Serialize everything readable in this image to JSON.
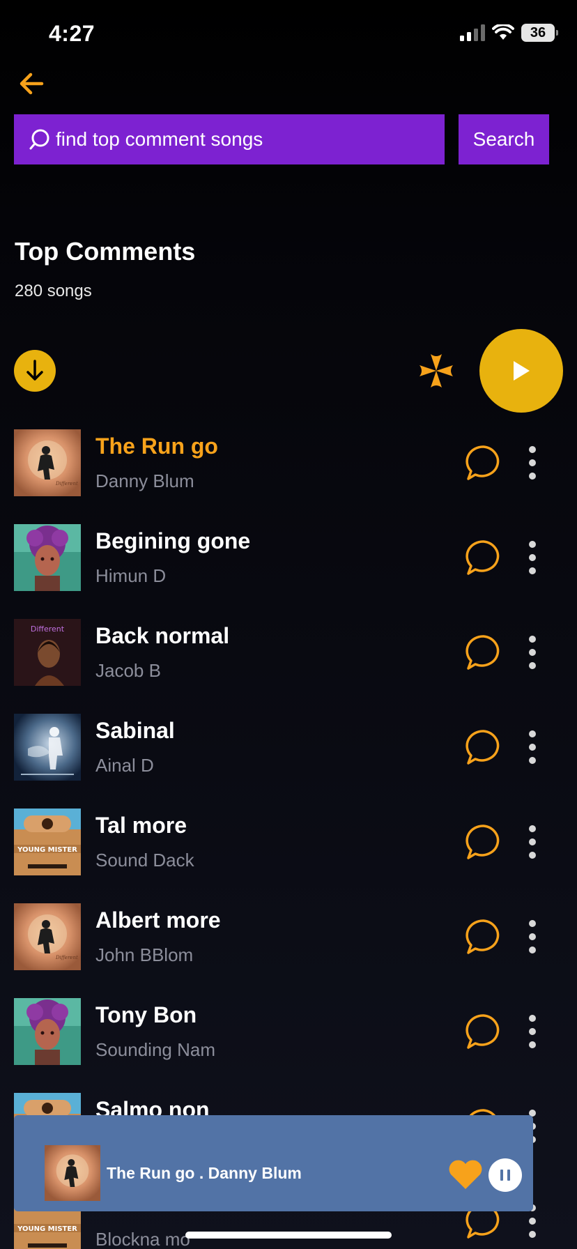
{
  "status_bar": {
    "time": "4:27",
    "battery": "36"
  },
  "search": {
    "placeholder": "find top comment songs",
    "value": "find top comment songs",
    "button_label": "Search"
  },
  "header": {
    "title": "Top Comments",
    "count": "280 songs"
  },
  "colors": {
    "accent": "#f7a21b",
    "purple": "#7d22d1",
    "gold": "#e8b20e",
    "player": "#5273a6"
  },
  "songs": [
    {
      "title": "The Run go",
      "artist": "Danny Blum",
      "art": "sunset-figure",
      "active": true
    },
    {
      "title": "Begining gone",
      "artist": "Himun D",
      "art": "purple-portrait",
      "active": false
    },
    {
      "title": "Back normal",
      "artist": "Jacob B",
      "art": "dark-portrait",
      "active": false
    },
    {
      "title": "Sabinal",
      "artist": "Ainal D",
      "art": "blue-dust",
      "active": false
    },
    {
      "title": "Tal more",
      "artist": "Sound Dack",
      "art": "guitar",
      "active": false
    },
    {
      "title": "Albert more",
      "artist": "John BBlom",
      "art": "sunset-figure",
      "active": false
    },
    {
      "title": "Tony Bon",
      "artist": "Sounding Nam",
      "art": "purple-portrait",
      "active": false
    },
    {
      "title": "Salmo non",
      "artist": "",
      "art": "guitar",
      "active": false
    },
    {
      "title": "",
      "artist": "Blockna mo",
      "art": "guitar",
      "active": false
    }
  ],
  "now_playing": {
    "label": "The Run go . Danny Blum"
  }
}
